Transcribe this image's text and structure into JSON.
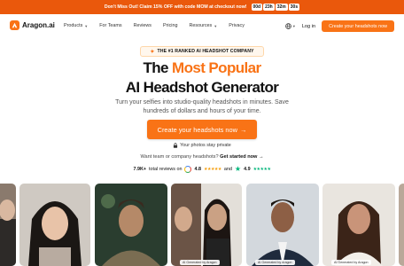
{
  "promo": {
    "text": "Don't Miss Out! Claim 15% OFF with code MOM at checkout now!",
    "timer": [
      "00d",
      "23h",
      "32m",
      "30s"
    ]
  },
  "nav": {
    "brand": "Aragon.ai",
    "links": [
      "Products",
      "For Teams",
      "Reviews",
      "Pricing",
      "Resources",
      "Privacy"
    ],
    "login": "Log in",
    "cta": "Create your headshots now"
  },
  "hero": {
    "badge": "THE #1 RANKED AI HEADSHOT COMPANY",
    "title_pre": "The ",
    "title_accent": "Most Popular",
    "title_line2": "AI Headshot Generator",
    "subtitle_line1": "Turn your selfies into studio-quality headshots in minutes. Save",
    "subtitle_line2": "hundreds of dollars and hours of your time.",
    "cta": "Create your headshots now",
    "cta_arrow": "→",
    "privacy": "Your photos stay private",
    "team_prefix": "Want team or company headshots?",
    "team_link": "Get started now →",
    "reviews_count": "7.9K+",
    "reviews_label": "total reviews on",
    "google_rating": "4.8",
    "and": "and",
    "trustpilot_rating": "4.9"
  },
  "photos": {
    "tags": [
      "AI Generated by Aragon",
      "AI Generated by Aragon",
      "AI Generated by Aragon"
    ]
  },
  "colors": {
    "accent": "#f97316",
    "promo_bg": "#ea580c",
    "google_stars": "#f59e0b",
    "trustpilot": "#00b67a"
  }
}
